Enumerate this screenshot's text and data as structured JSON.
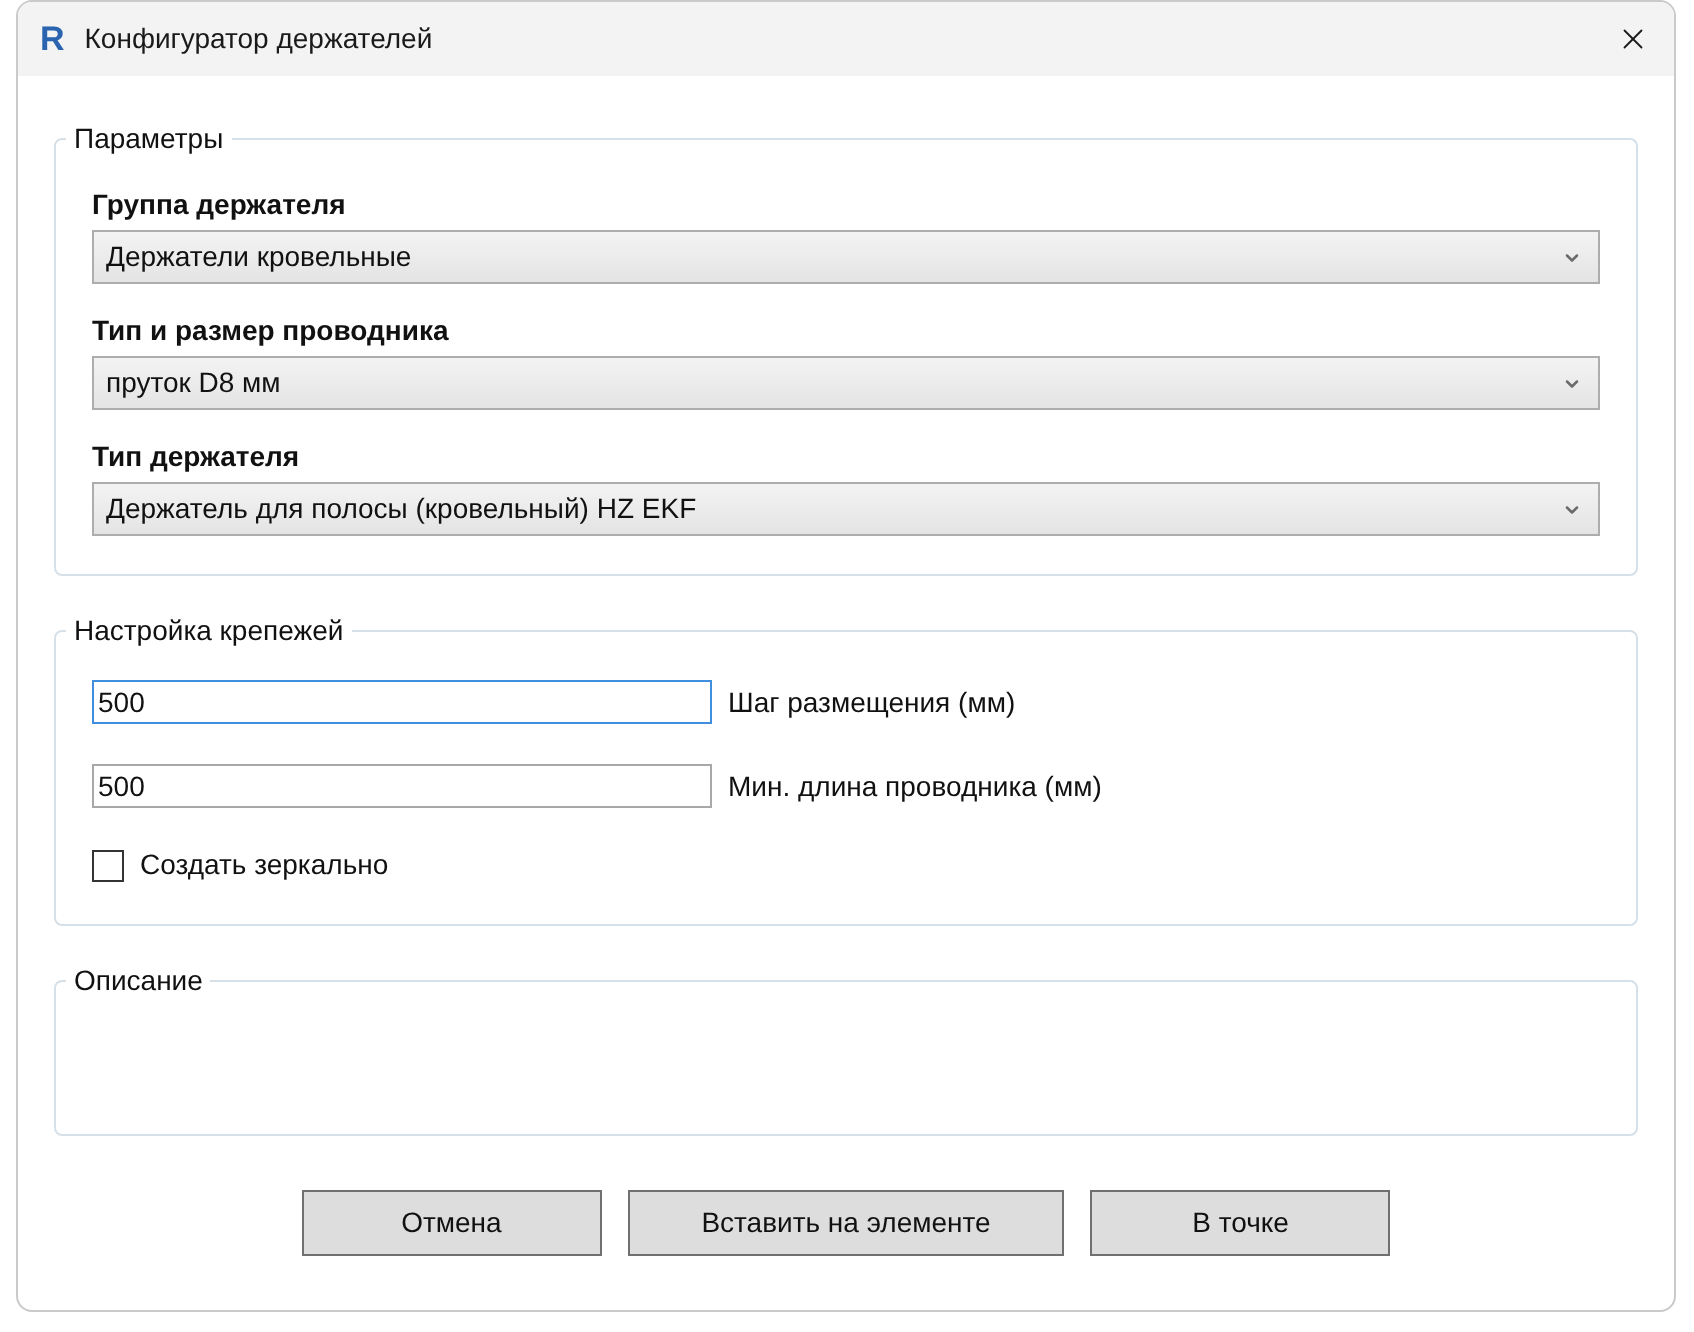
{
  "window": {
    "icon_letter": "R",
    "title": "Конфигуратор держателей"
  },
  "parameters": {
    "legend": "Параметры",
    "fields": [
      {
        "label": "Группа держателя",
        "value": "Держатели кровельные"
      },
      {
        "label": "Тип и размер проводника",
        "value": "пруток D8 мм"
      },
      {
        "label": "Тип держателя",
        "value": "Держатель для полосы (кровельный) HZ EKF"
      }
    ]
  },
  "fasteners": {
    "legend": "Настройка крепежей",
    "inputs": [
      {
        "value": "500",
        "label": "Шаг размещения (мм)",
        "focused": true
      },
      {
        "value": "500",
        "label": "Мин. длина проводника (мм)",
        "focused": false
      }
    ],
    "checkbox": {
      "label": "Создать зеркально",
      "checked": false
    }
  },
  "description": {
    "legend": "Описание"
  },
  "buttons": [
    {
      "label": "Отмена"
    },
    {
      "label": "Вставить на элементе"
    },
    {
      "label": "В точке"
    }
  ]
}
